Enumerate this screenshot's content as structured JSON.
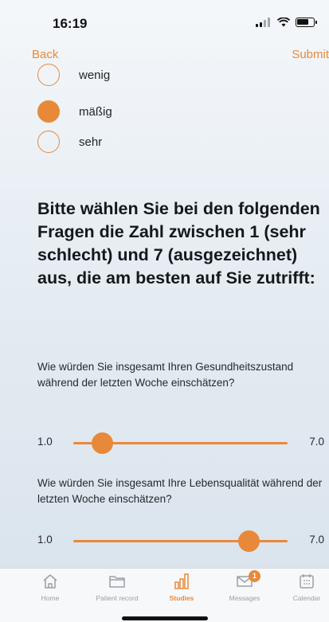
{
  "status_bar": {
    "time": "16:19"
  },
  "nav": {
    "back_label": "Back",
    "submit_label": "Submit"
  },
  "options": [
    {
      "label": "wenig",
      "selected": false
    },
    {
      "label": "mäßig",
      "selected": true
    },
    {
      "label": "sehr",
      "selected": false
    }
  ],
  "prompt": "Bitte wählen Sie bei den folgenden Fragen die Zahl zwischen 1 (sehr schlecht) und 7 (ausgezeichnet) aus, die am besten auf Sie zutrifft:",
  "questions": [
    {
      "text": "Wie würden Sie insgesamt Ihren Gesundheitszustand während der letzten Woche einschätzen?",
      "min_label": "1.0",
      "max_label": "7.0",
      "min": 1,
      "max": 7,
      "value": 1.8
    },
    {
      "text": "Wie würden Sie insgesamt Ihre Lebensqualität während der letzten Woche einschätzen?",
      "min_label": "1.0",
      "max_label": "7.0",
      "min": 1,
      "max": 7,
      "value": 5.9
    }
  ],
  "tabs": [
    {
      "label": "Home",
      "icon": "home-icon",
      "active": false
    },
    {
      "label": "Patient record",
      "icon": "folder-icon",
      "active": false
    },
    {
      "label": "Studies",
      "icon": "bar-chart-icon",
      "active": true
    },
    {
      "label": "Messages",
      "icon": "envelope-icon",
      "active": false,
      "badge": "1"
    },
    {
      "label": "Calendar",
      "icon": "calendar-icon",
      "active": false
    }
  ],
  "colors": {
    "accent": "#e8893a",
    "text": "#1f2326",
    "tab_inactive": "#9aa0a6"
  }
}
